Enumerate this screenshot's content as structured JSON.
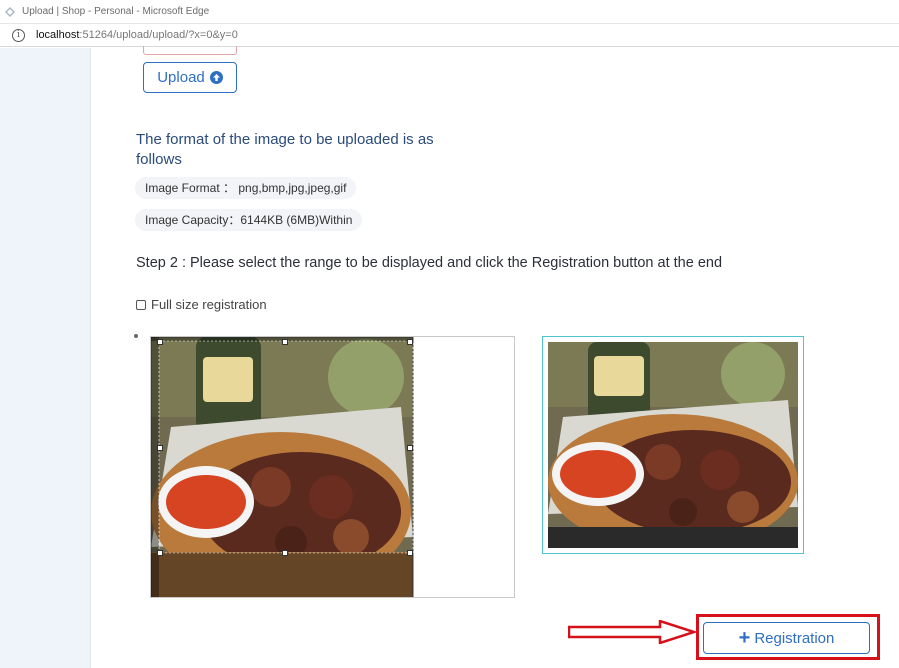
{
  "browser": {
    "window_title": "Upload | Shop - Personal - Microsoft Edge",
    "url_host": "localhost",
    "url_path": ":51264/upload/upload/?x=0&y=0"
  },
  "upload": {
    "button_label": "Upload",
    "icon": "arrow-up-circle-icon"
  },
  "format_info": {
    "title": "The format of the image to be uploaded is as follows",
    "image_format": "Image Format ： png,bmp,jpg,jpeg,gif",
    "image_capacity": "Image Capacity：6144KB (6MB)Within"
  },
  "step2": {
    "text": "Step 2 : Please select the range to be displayed and click the Registration button at the end",
    "full_size_label": "Full size registration",
    "full_size_checked": false
  },
  "registration": {
    "button_label": "Registration",
    "icon": "plus-icon",
    "highlight_color": "#d6111a"
  },
  "colors": {
    "accent": "#2f6fc3",
    "title_text": "#2b4b7a",
    "preview_border": "#4fc3c9"
  }
}
